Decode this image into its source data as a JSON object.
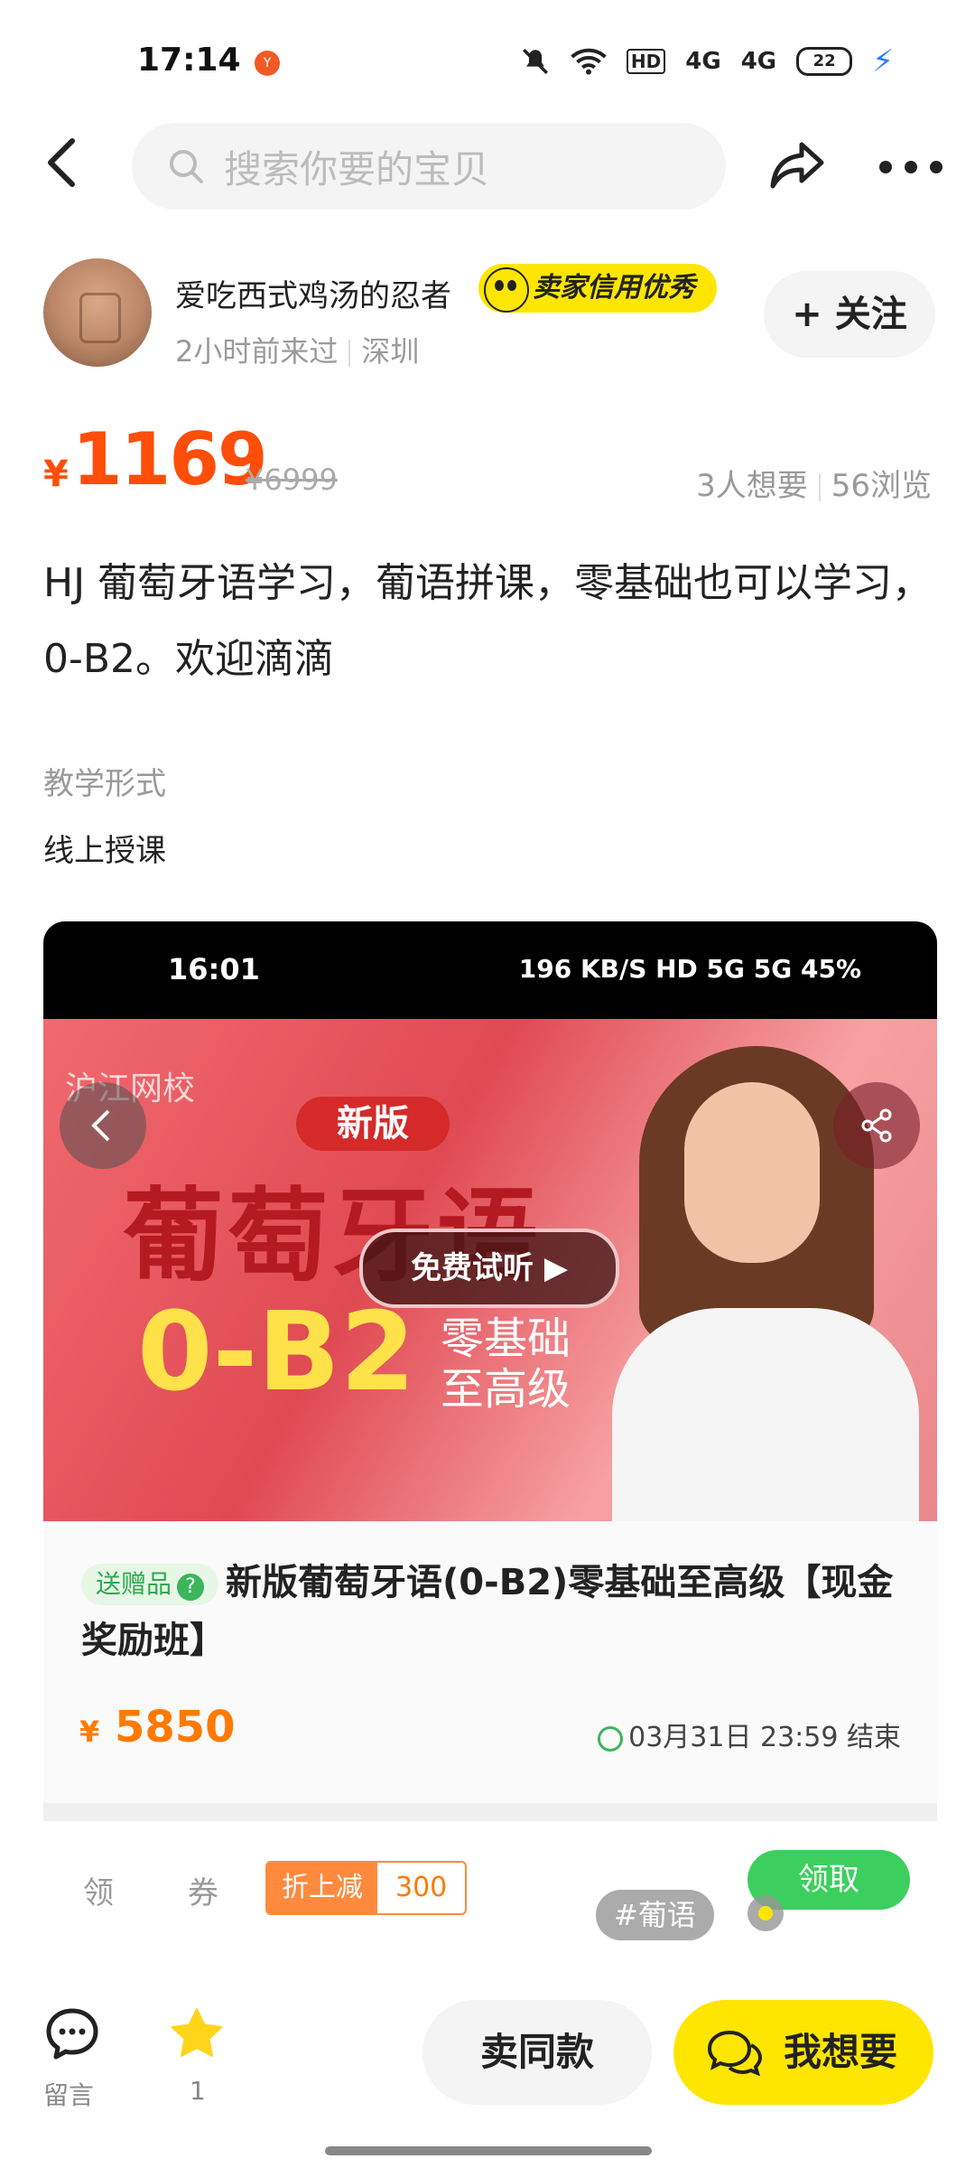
{
  "status_bar": {
    "time": "17:14",
    "app_badge": "Y",
    "network": "HD",
    "signal1": "4G",
    "signal2": "4G",
    "battery": "22"
  },
  "nav": {
    "search_placeholder": "搜索你要的宝贝"
  },
  "seller": {
    "name": "爱吃西式鸡汤的忍者",
    "badge": "卖家信用优秀",
    "last_seen": "2小时前来过",
    "location": "深圳",
    "follow_label": "+ 关注"
  },
  "price": {
    "currency": "¥",
    "current": "1169",
    "original": "¥6999",
    "wants": "3人想要",
    "views": "56浏览"
  },
  "description": "HJ 葡萄牙语学习，葡语拼课，零基础也可以学习，0-B2。欢迎滴滴",
  "attribute": {
    "key": "教学形式",
    "value": "线上授课"
  },
  "screenshot": {
    "time": "16:01",
    "status_right": "196 KB/S  HD  5G  5G  45%",
    "banner": {
      "logo": "沪江网校",
      "version": "新版",
      "title": "葡萄牙语",
      "level": "0-B2",
      "subtitle_line1": "零基础",
      "subtitle_line2": "至高级",
      "trial": "免费试听 ▶"
    },
    "gift_tag": "送赠品",
    "course_title": "新版葡萄牙语(0-B2)零基础至高级【现金奖励班】",
    "course_currency": "¥",
    "course_price": "5850",
    "deadline": "03月31日 23:59 结束",
    "coupon_label1": "领",
    "coupon_label2": "券",
    "coupon_tag_a": "折上减",
    "coupon_tag_b": "300",
    "coupon_get": "领取",
    "hashtag": "#葡语"
  },
  "bottom_bar": {
    "message_label": "留言",
    "favorite_count": "1",
    "sell_same": "卖同款",
    "want": "我想要"
  },
  "colors": {
    "accent_orange": "#ff4d0a",
    "brand_yellow": "#ffe600",
    "green": "#3ccf5e"
  }
}
